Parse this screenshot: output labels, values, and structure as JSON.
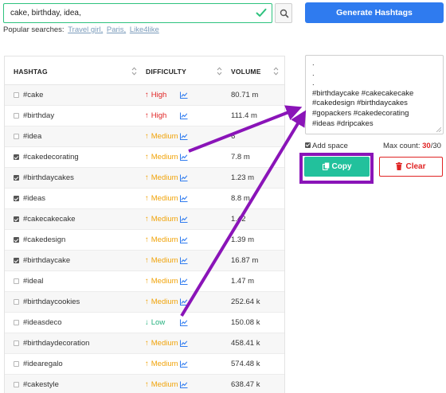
{
  "search": {
    "value": "cake, birthday, idea,"
  },
  "generate_button": "Generate Hashtags",
  "popular": {
    "label": "Popular searches:",
    "items": [
      "Travel girl,",
      "Paris,",
      "Like4like"
    ]
  },
  "table": {
    "headers": {
      "hashtag": "HASHTAG",
      "difficulty": "DIFFICULTY",
      "volume": "VOLUME"
    },
    "rows": [
      {
        "tag": "#cake",
        "difficulty": "High",
        "level": "high",
        "volume": "80.71 m",
        "checked": false
      },
      {
        "tag": "#birthday",
        "difficulty": "High",
        "level": "high",
        "volume": "111.4 m",
        "checked": false
      },
      {
        "tag": "#idea",
        "difficulty": "Medium",
        "level": "medium",
        "volume": "6",
        "checked": false
      },
      {
        "tag": "#cakedecorating",
        "difficulty": "Medium",
        "level": "medium",
        "volume": "7.8 m",
        "checked": true
      },
      {
        "tag": "#birthdaycakes",
        "difficulty": "Medium",
        "level": "medium",
        "volume": "1.23 m",
        "checked": true
      },
      {
        "tag": "#ideas",
        "difficulty": "Medium",
        "level": "medium",
        "volume": "8.8 m",
        "checked": true
      },
      {
        "tag": "#cakecakecake",
        "difficulty": "Medium",
        "level": "medium",
        "volume": "1.42",
        "checked": true
      },
      {
        "tag": "#cakedesign",
        "difficulty": "Medium",
        "level": "medium",
        "volume": "1.39 m",
        "checked": true
      },
      {
        "tag": "#birthdaycake",
        "difficulty": "Medium",
        "level": "medium",
        "volume": "16.87 m",
        "checked": true
      },
      {
        "tag": "#ideal",
        "difficulty": "Medium",
        "level": "medium",
        "volume": "1.47 m",
        "checked": false
      },
      {
        "tag": "#birthdaycookies",
        "difficulty": "Medium",
        "level": "medium",
        "volume": "252.64 k",
        "checked": false
      },
      {
        "tag": "#ideasdeco",
        "difficulty": "Low",
        "level": "low",
        "volume": "150.08 k",
        "checked": false
      },
      {
        "tag": "#birthdaydecoration",
        "difficulty": "Medium",
        "level": "medium",
        "volume": "458.41 k",
        "checked": false
      },
      {
        "tag": "#idearegalo",
        "difficulty": "Medium",
        "level": "medium",
        "volume": "574.48 k",
        "checked": false
      },
      {
        "tag": "#cakestyle",
        "difficulty": "Medium",
        "level": "medium",
        "volume": "638.47 k",
        "checked": false
      }
    ]
  },
  "result": {
    "lines": [
      ".",
      ".",
      ".",
      "#birthdaycake #cakecakecake",
      "#cakedesign #birthdaycakes",
      "#gopackers #cakedecorating",
      "#ideas #dripcakes"
    ]
  },
  "add_space_label": "Add space",
  "max_count": {
    "label": "Max count:",
    "current": "30",
    "total": "/30"
  },
  "copy_button": "Copy",
  "clear_button": "Clear",
  "colors": {
    "accent_blue": "#2f7bef",
    "copy_green": "#22c19c",
    "annotation_purple": "#8a14b8",
    "high": "#e02424",
    "medium": "#f0a30a",
    "low": "#22b07d"
  },
  "icons": {
    "search": "magnifier-icon",
    "valid": "checkmark-icon",
    "trend": "line-chart-icon",
    "sort": "sort-arrows-icon",
    "copy": "copy-icon",
    "clear": "trash-icon"
  }
}
